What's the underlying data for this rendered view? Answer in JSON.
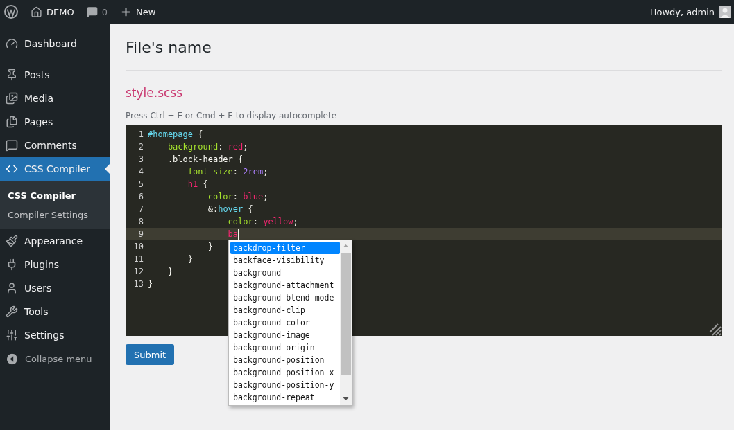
{
  "admin_bar": {
    "site": "DEMO",
    "comments_count": "0",
    "new_label": "New",
    "greeting": "Howdy, admin"
  },
  "sidebar": {
    "items": [
      {
        "label": "Dashboard",
        "selected": false
      },
      {
        "label": "Posts",
        "selected": false
      },
      {
        "label": "Media",
        "selected": false
      },
      {
        "label": "Pages",
        "selected": false
      },
      {
        "label": "Comments",
        "selected": false
      },
      {
        "label": "CSS Compiler",
        "selected": true,
        "submenu": [
          {
            "label": "CSS Compiler",
            "selected": true
          },
          {
            "label": "Compiler Settings",
            "selected": false
          }
        ]
      },
      {
        "label": "Appearance",
        "selected": false
      },
      {
        "label": "Plugins",
        "selected": false
      },
      {
        "label": "Users",
        "selected": false
      },
      {
        "label": "Tools",
        "selected": false
      },
      {
        "label": "Settings",
        "selected": false
      }
    ],
    "collapse_label": "Collapse menu"
  },
  "page": {
    "title": "File's name",
    "file_name": "style.scss",
    "hint": "Press Ctrl + E or Cmd + E to display autocomplete",
    "submit_label": "Submit"
  },
  "editor": {
    "lines": [
      {
        "number": "1",
        "active": false,
        "tokens": [
          {
            "kind": "selector",
            "text": "#homepage"
          },
          {
            "kind": "punct",
            "text": " {"
          }
        ]
      },
      {
        "number": "2",
        "active": false,
        "tokens": [
          {
            "kind": "property",
            "text": "    background"
          },
          {
            "kind": "punct",
            "text": ": "
          },
          {
            "kind": "value",
            "text": "red"
          },
          {
            "kind": "punct",
            "text": ";"
          }
        ]
      },
      {
        "number": "3",
        "active": false,
        "tokens": [
          {
            "kind": "punct",
            "text": "    .block-header {"
          }
        ]
      },
      {
        "number": "4",
        "active": false,
        "tokens": [
          {
            "kind": "property",
            "text": "        font-size"
          },
          {
            "kind": "punct",
            "text": ": "
          },
          {
            "kind": "number",
            "text": "2rem"
          },
          {
            "kind": "punct",
            "text": ";"
          }
        ]
      },
      {
        "number": "5",
        "active": false,
        "tokens": [
          {
            "kind": "value",
            "text": "        h1"
          },
          {
            "kind": "punct",
            "text": " {"
          }
        ]
      },
      {
        "number": "6",
        "active": false,
        "tokens": [
          {
            "kind": "property",
            "text": "            color"
          },
          {
            "kind": "punct",
            "text": ": "
          },
          {
            "kind": "value",
            "text": "blue"
          },
          {
            "kind": "punct",
            "text": ";"
          }
        ]
      },
      {
        "number": "7",
        "active": false,
        "tokens": [
          {
            "kind": "punct",
            "text": "            &:"
          },
          {
            "kind": "selector",
            "text": "hover"
          },
          {
            "kind": "punct",
            "text": " {"
          }
        ]
      },
      {
        "number": "8",
        "active": false,
        "tokens": [
          {
            "kind": "property",
            "text": "                color"
          },
          {
            "kind": "punct",
            "text": ": "
          },
          {
            "kind": "value",
            "text": "yellow"
          },
          {
            "kind": "punct",
            "text": ";"
          }
        ]
      },
      {
        "number": "9",
        "active": true,
        "tokens": [
          {
            "kind": "value",
            "text": "                ba"
          }
        ]
      },
      {
        "number": "10",
        "active": false,
        "tokens": [
          {
            "kind": "punct",
            "text": "            }"
          }
        ]
      },
      {
        "number": "11",
        "active": false,
        "tokens": [
          {
            "kind": "punct",
            "text": "        }"
          }
        ]
      },
      {
        "number": "12",
        "active": false,
        "tokens": [
          {
            "kind": "punct",
            "text": "    }"
          }
        ]
      },
      {
        "number": "13",
        "active": false,
        "tokens": [
          {
            "kind": "punct",
            "text": "}"
          }
        ]
      }
    ],
    "autocomplete": [
      {
        "label": "backdrop-filter",
        "selected": true
      },
      {
        "label": "backface-visibility",
        "selected": false
      },
      {
        "label": "background",
        "selected": false
      },
      {
        "label": "background-attachment",
        "selected": false
      },
      {
        "label": "background-blend-mode",
        "selected": false
      },
      {
        "label": "background-clip",
        "selected": false
      },
      {
        "label": "background-color",
        "selected": false
      },
      {
        "label": "background-image",
        "selected": false
      },
      {
        "label": "background-origin",
        "selected": false
      },
      {
        "label": "background-position",
        "selected": false
      },
      {
        "label": "background-position-x",
        "selected": false
      },
      {
        "label": "background-position-y",
        "selected": false
      },
      {
        "label": "background-repeat",
        "selected": false
      }
    ]
  }
}
